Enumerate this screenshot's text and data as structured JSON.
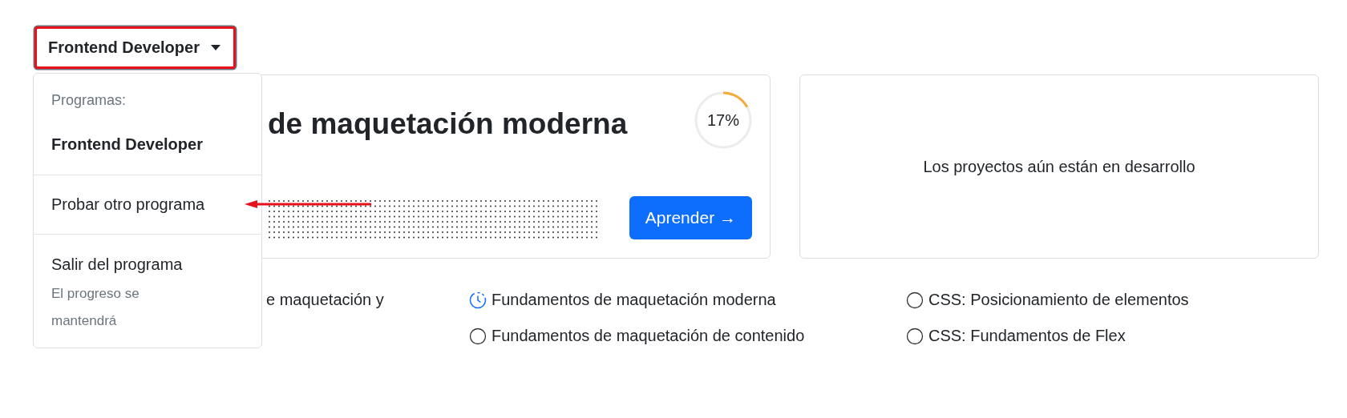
{
  "program_button": {
    "label": "Frontend Developer",
    "expanded": true
  },
  "menu": {
    "header": "Programas:",
    "current": "Frontend Developer",
    "items": [
      {
        "label": "Probar otro programa",
        "kind": "action"
      },
      {
        "label": "Salir del programa",
        "note": "El progreso se mantendrá",
        "kind": "exit"
      }
    ]
  },
  "course_card": {
    "title": "de maquetación moderna",
    "progress": {
      "level": 0.17,
      "reading": "17%"
    },
    "button": "Aprender →"
  },
  "projects_card": {
    "message": "Los proyectos aún están en desarrollo"
  },
  "courses": [
    {
      "title": "e maquetación y",
      "kind": "partial"
    },
    {
      "title": "Fundamentos de maquetación moderna",
      "kind": "in_progress"
    },
    {
      "title": "CSS: Posicionamiento de elementos",
      "kind": "not_started"
    },
    {
      "title": "Fundamentos de maquetación de contenido",
      "kind": "not_started"
    },
    {
      "title": "CSS: Fundamentos de Flex",
      "kind": "not_started"
    }
  ]
}
